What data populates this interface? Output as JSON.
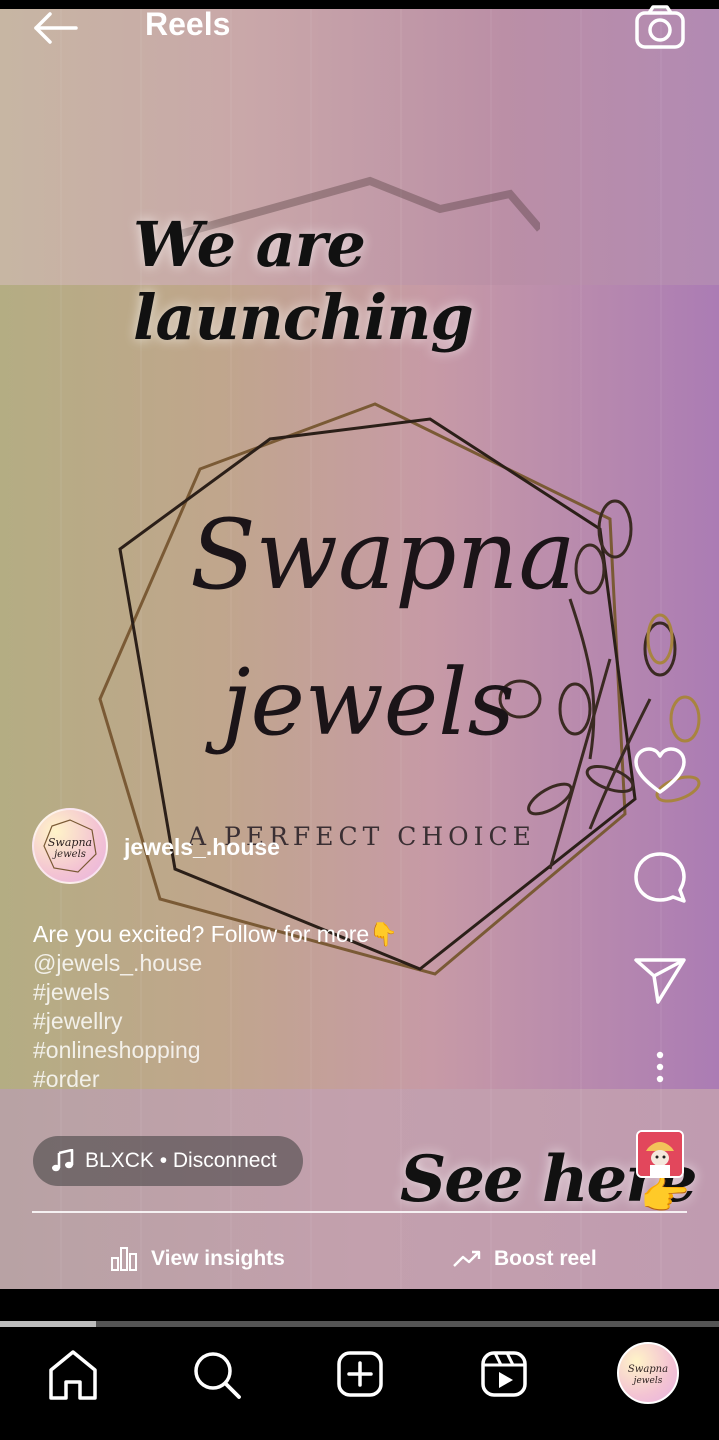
{
  "header": {
    "title": "Reels",
    "back_icon": "arrow-left-icon",
    "camera_icon": "camera-icon"
  },
  "reel": {
    "overlay_top": "We are launching",
    "brand_line1": "Swapna",
    "brand_line2": "jewels",
    "brand_tagline": "A PERFECT CHOICE",
    "overlay_bottom": "See here",
    "overlay_bottom_emoji": "👉"
  },
  "author": {
    "username": "jewels_.house"
  },
  "caption": {
    "text": "Are you excited? Follow for more👇",
    "mention": "@jewels_.house",
    "hashtags": [
      "#jewels",
      "#jewellry",
      "#onlineshopping",
      "#order"
    ]
  },
  "audio": {
    "label": "BLXCK • Disconnect",
    "icon": "music-note-icon"
  },
  "actions": {
    "like_icon": "heart-icon",
    "comment_icon": "comment-icon",
    "share_icon": "send-icon",
    "more_icon": "more-vertical-icon"
  },
  "footer": {
    "insights_label": "View insights",
    "boost_label": "Boost reel"
  },
  "progress": 0.133,
  "nav": {
    "items": [
      "home-icon",
      "search-icon",
      "create-icon",
      "reels-icon",
      "profile-avatar"
    ]
  },
  "colors": {
    "accent_white": "#ffffff",
    "background": "#000000"
  }
}
